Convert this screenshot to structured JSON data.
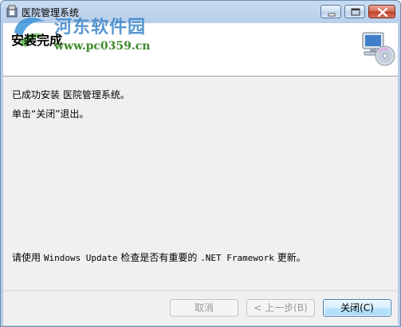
{
  "window": {
    "title": "医院管理系统",
    "controls": {
      "minimize": "minimize",
      "maximize": "maximize",
      "close": "close"
    }
  },
  "header": {
    "title": "安装完成",
    "watermark": {
      "name": "河东软件园",
      "url": "www.pc0359.cn"
    },
    "icon": "computer-with-disc-icon"
  },
  "content": {
    "line1": "已成功安装 医院管理系统。",
    "line2": "单击“关闭”退出。",
    "line3_prefix": "请使用 ",
    "line3_windows_update": "Windows Update",
    "line3_middle": " 检查是否有重要的 ",
    "line3_framework": ".NET Framework",
    "line3_suffix": " 更新。"
  },
  "footer": {
    "cancel_label": "取消",
    "back_label": "< 上一步(B)",
    "close_label": "关闭(C)"
  },
  "colors": {
    "titlebar": "#b7cde8",
    "primary_button_border": "#3c7fb1",
    "watermark_blue": "#3b86c9",
    "watermark_green": "#3e8a2a"
  }
}
